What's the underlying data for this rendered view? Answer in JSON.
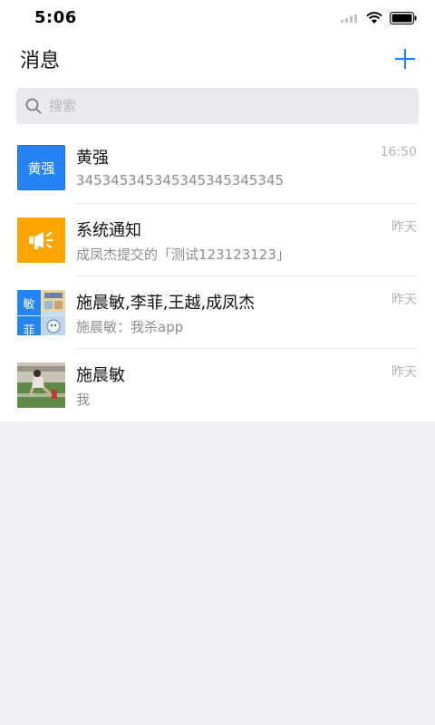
{
  "status_bar": {
    "time": "5:06"
  },
  "header": {
    "title": "消息"
  },
  "search": {
    "placeholder": "搜索"
  },
  "conversations": [
    {
      "name": "黄强",
      "preview": "345345345345345345345345",
      "time": "16:50",
      "avatar_text": "黄强"
    },
    {
      "name": "系统通知",
      "preview": "成凤杰提交的「测试123123123」",
      "time": "昨天"
    },
    {
      "name": "施晨敏,李菲,王越,成凤杰",
      "preview": "施晨敏：我杀app",
      "time": "昨天",
      "avatar_cells": [
        "敏",
        "菲"
      ]
    },
    {
      "name": "施晨敏",
      "preview": "我",
      "time": "昨天"
    }
  ],
  "colors": {
    "accent": "#2684f2",
    "notice": "#ffa300",
    "background": "#eff0f4"
  }
}
